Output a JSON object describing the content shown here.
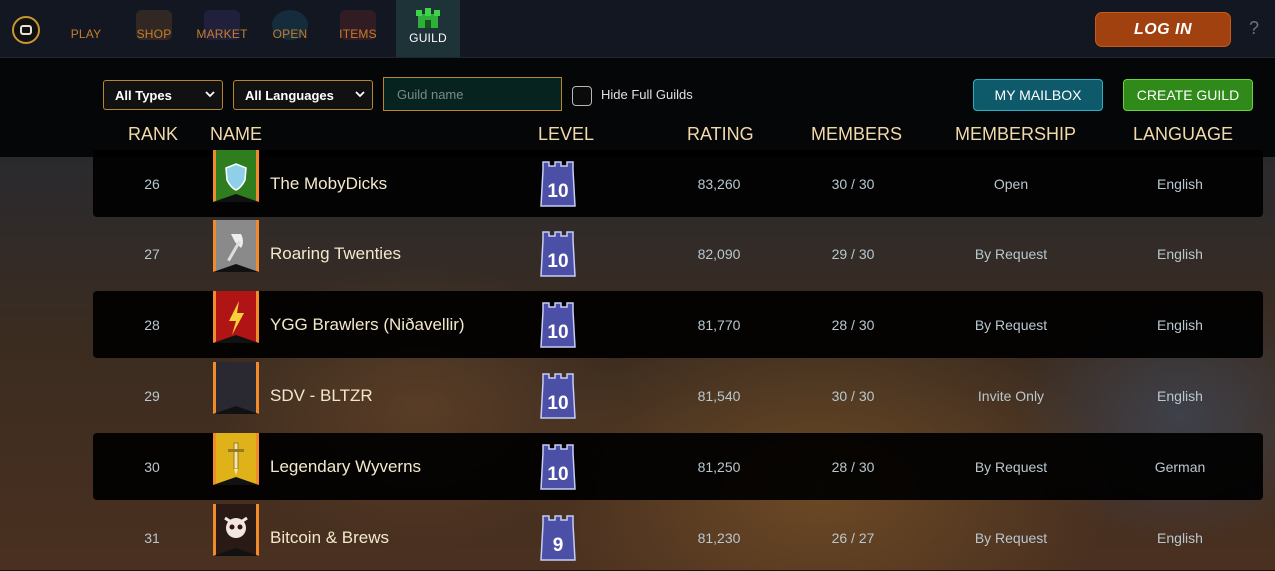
{
  "nav": {
    "items": [
      {
        "label": "PLAY"
      },
      {
        "label": "SHOP"
      },
      {
        "label": "MARKET"
      },
      {
        "label": "OPEN"
      },
      {
        "label": "ITEMS"
      },
      {
        "label": "GUILD"
      }
    ],
    "active": "GUILD",
    "login_label": "LOG IN",
    "help_label": "?"
  },
  "filters": {
    "type_select": "All Types",
    "language_select": "All Languages",
    "name_placeholder": "Guild name",
    "hide_full_label": "Hide Full Guilds",
    "mailbox_label": "MY MAILBOX",
    "create_label": "CREATE GUILD"
  },
  "columns": {
    "rank": "RANK",
    "name": "NAME",
    "level": "LEVEL",
    "rating": "RATING",
    "members": "MEMBERS",
    "membership": "MEMBERSHIP",
    "language": "LANGUAGE"
  },
  "rows": [
    {
      "rank": "26",
      "name": "The MobyDicks",
      "level": "10",
      "rating": "83,260",
      "members": "30 / 30",
      "membership": "Open",
      "language": "English",
      "banner_color": "#2e7d1e",
      "banner_icon": "shield-icon"
    },
    {
      "rank": "27",
      "name": "Roaring Twenties",
      "level": "10",
      "rating": "82,090",
      "members": "29 / 30",
      "membership": "By Request",
      "language": "English",
      "banner_color": "#8a8a8a",
      "banner_icon": "axe-icon"
    },
    {
      "rank": "28",
      "name": "YGG Brawlers (Niðavellir)",
      "level": "10",
      "rating": "81,770",
      "members": "28 / 30",
      "membership": "By Request",
      "language": "English",
      "banner_color": "#b01414",
      "banner_icon": "lightning-icon"
    },
    {
      "rank": "29",
      "name": "SDV - BLTZR",
      "level": "10",
      "rating": "81,540",
      "members": "30 / 30",
      "membership": "Invite Only",
      "language": "English",
      "banner_color": "#2a2830",
      "banner_icon": "blank-icon"
    },
    {
      "rank": "30",
      "name": "Legendary Wyverns",
      "level": "10",
      "rating": "81,250",
      "members": "28 / 30",
      "membership": "By Request",
      "language": "German",
      "banner_color": "#e0b21a",
      "banner_icon": "sword-icon"
    },
    {
      "rank": "31",
      "name": "Bitcoin & Brews",
      "level": "9",
      "rating": "81,230",
      "members": "26 / 27",
      "membership": "By Request",
      "language": "English",
      "banner_color": "#2a1a16",
      "banner_icon": "skull-icon"
    }
  ],
  "colors": {
    "accent_gold": "#b8862a",
    "login": "#a0410f",
    "mailbox": "#0e5a6a",
    "create": "#2f8a1a",
    "header_text": "#f1d9a9"
  }
}
